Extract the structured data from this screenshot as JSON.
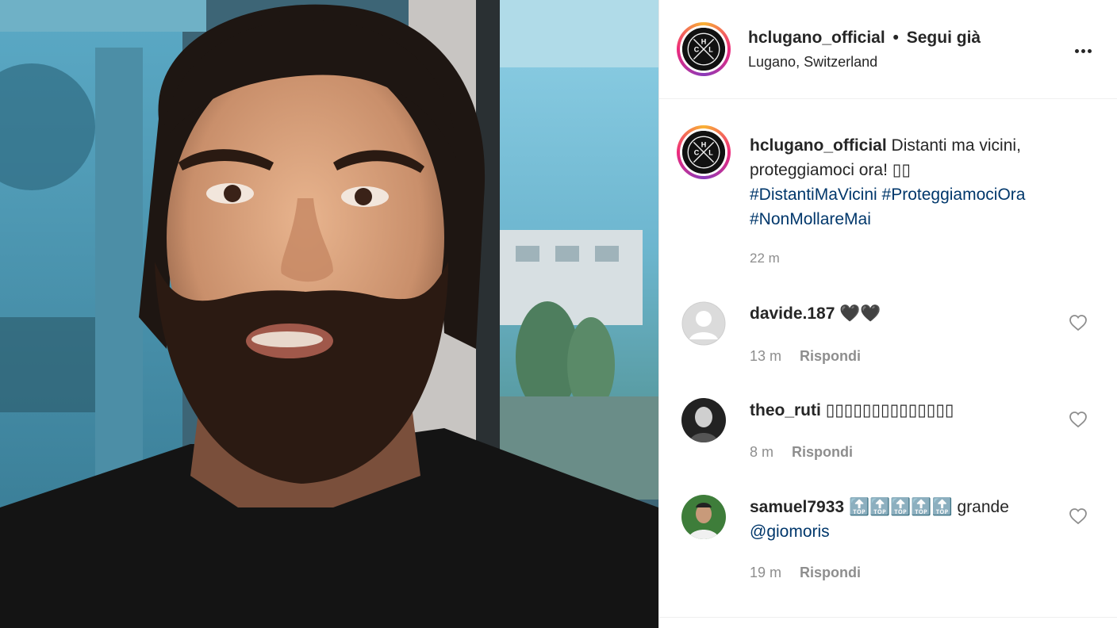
{
  "post": {
    "author": "hclugano_official",
    "separator": "•",
    "follow_status": "Segui già",
    "location": "Lugano, Switzerland",
    "more_icon": "more-horizontal-icon"
  },
  "caption": {
    "author": "hclugano_official",
    "text": "Distanti ma vicini, proteggiamoci ora! ▯▯",
    "hashtags": [
      "#DistantiMaVicini",
      "#ProteggiamociOra",
      "#NonMollareMai"
    ],
    "time": "22 m"
  },
  "comments": [
    {
      "user": "davide.187",
      "text": "🖤🖤",
      "mention": "",
      "time": "13 m",
      "reply_label": "Rispondi",
      "avatar": "default-avatar-icon"
    },
    {
      "user": "theo_ruti",
      "text": "▯▯▯▯▯▯▯▯▯▯▯▯▯▯",
      "mention": "",
      "time": "8 m",
      "reply_label": "Rispondi",
      "avatar": "user-photo"
    },
    {
      "user": "samuel7933",
      "text": "🔝🔝🔝🔝🔝 grande",
      "mention": "@giomoris",
      "time": "19 m",
      "reply_label": "Rispondi",
      "avatar": "user-photo"
    }
  ],
  "colors": {
    "link": "#00376b",
    "muted": "#8e8e8e",
    "text": "#262626",
    "story_ring": [
      "#f9b233",
      "#ee2a7b",
      "#8a3ab9"
    ]
  }
}
